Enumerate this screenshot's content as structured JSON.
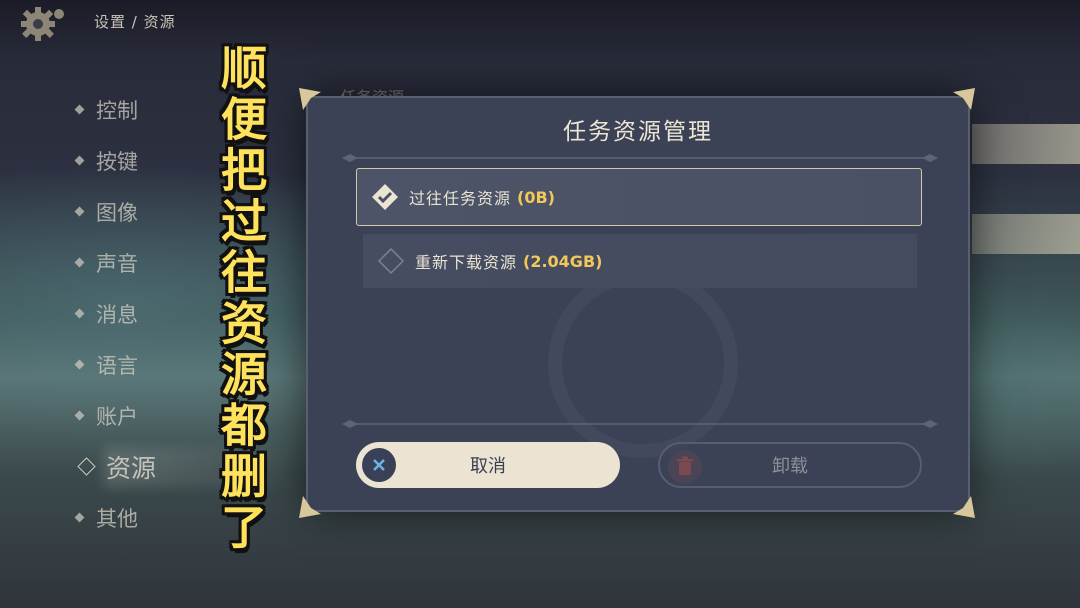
{
  "header": {
    "breadcrumb": "设置 / 资源",
    "gear_icon": "gear-icon"
  },
  "sidebar": {
    "items": [
      {
        "label": "控制"
      },
      {
        "label": "按键"
      },
      {
        "label": "图像"
      },
      {
        "label": "声音"
      },
      {
        "label": "消息"
      },
      {
        "label": "语言"
      },
      {
        "label": "账户"
      },
      {
        "label": "资源",
        "active": true
      },
      {
        "label": "其他"
      }
    ]
  },
  "background_panel": {
    "partial_title": "任务资源"
  },
  "caption": {
    "text": "顺便把过往资源都删了",
    "color": "#ffe25b"
  },
  "dialog": {
    "title": "任务资源管理",
    "options": [
      {
        "label": "过往任务资源",
        "size": "(0B)",
        "selected": true,
        "icon": "checked-diamond-icon"
      },
      {
        "label": "重新下载资源",
        "size": "(2.04GB)",
        "selected": false,
        "icon": "unchecked-diamond-icon"
      }
    ],
    "cancel_label": "取消",
    "uninstall_label": "卸载",
    "accent_color": "#f2c85a"
  }
}
